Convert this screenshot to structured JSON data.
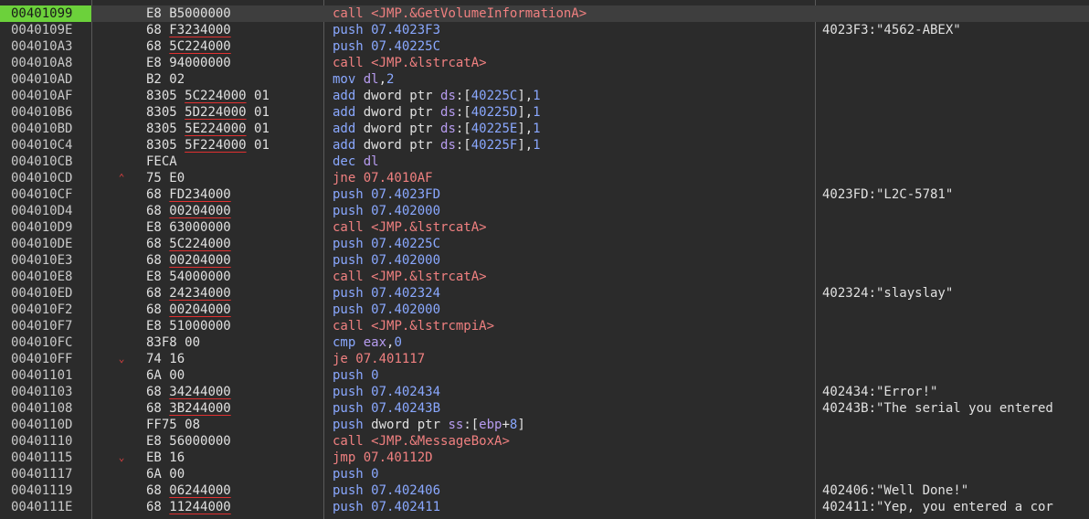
{
  "rows": [
    {
      "addr": "00401099",
      "bytes": "E8",
      "op": "B5000000",
      "ul": false,
      "arrow": "",
      "mn": "call",
      "args": [
        {
          "t": "<JMP.&GetVolumeInformationA>",
          "c": "tgt"
        }
      ],
      "cmt": "",
      "sel": true
    },
    {
      "addr": "0040109E",
      "bytes": "68",
      "op": "F3234000",
      "ul": true,
      "arrow": "",
      "mn": "push",
      "args": [
        {
          "t": "07.4023F3",
          "c": "num"
        }
      ],
      "cmt": "4023F3:\"4562-ABEX\""
    },
    {
      "addr": "004010A3",
      "bytes": "68",
      "op": "5C224000",
      "ul": true,
      "arrow": "",
      "mn": "push",
      "args": [
        {
          "t": "07.40225C",
          "c": "num"
        }
      ],
      "cmt": ""
    },
    {
      "addr": "004010A8",
      "bytes": "E8",
      "op": "94000000",
      "ul": false,
      "arrow": "",
      "mn": "call",
      "args": [
        {
          "t": "<JMP.&lstrcatA>",
          "c": "tgt"
        }
      ],
      "cmt": ""
    },
    {
      "addr": "004010AD",
      "bytes": "B2",
      "op": "02",
      "ul": false,
      "arrow": "",
      "mn": "mov",
      "args": [
        {
          "t": "dl",
          "c": "reg"
        },
        {
          "t": ",",
          "c": "txt"
        },
        {
          "t": "2",
          "c": "num"
        }
      ],
      "cmt": ""
    },
    {
      "addr": "004010AF",
      "bytes": "8305",
      "op": "5C224000",
      "tail": "01",
      "ul": true,
      "arrow": "",
      "mn": "add",
      "args": [
        {
          "t": "dword ptr ",
          "c": "txt"
        },
        {
          "t": "ds",
          "c": "reg"
        },
        {
          "t": ":[",
          "c": "txt"
        },
        {
          "t": "40225C",
          "c": "num"
        },
        {
          "t": "],",
          "c": "txt"
        },
        {
          "t": "1",
          "c": "num"
        }
      ],
      "cmt": ""
    },
    {
      "addr": "004010B6",
      "bytes": "8305",
      "op": "5D224000",
      "tail": "01",
      "ul": true,
      "arrow": "",
      "mn": "add",
      "args": [
        {
          "t": "dword ptr ",
          "c": "txt"
        },
        {
          "t": "ds",
          "c": "reg"
        },
        {
          "t": ":[",
          "c": "txt"
        },
        {
          "t": "40225D",
          "c": "num"
        },
        {
          "t": "],",
          "c": "txt"
        },
        {
          "t": "1",
          "c": "num"
        }
      ],
      "cmt": ""
    },
    {
      "addr": "004010BD",
      "bytes": "8305",
      "op": "5E224000",
      "tail": "01",
      "ul": true,
      "arrow": "",
      "mn": "add",
      "args": [
        {
          "t": "dword ptr ",
          "c": "txt"
        },
        {
          "t": "ds",
          "c": "reg"
        },
        {
          "t": ":[",
          "c": "txt"
        },
        {
          "t": "40225E",
          "c": "num"
        },
        {
          "t": "],",
          "c": "txt"
        },
        {
          "t": "1",
          "c": "num"
        }
      ],
      "cmt": ""
    },
    {
      "addr": "004010C4",
      "bytes": "8305",
      "op": "5F224000",
      "tail": "01",
      "ul": true,
      "arrow": "",
      "mn": "add",
      "args": [
        {
          "t": "dword ptr ",
          "c": "txt"
        },
        {
          "t": "ds",
          "c": "reg"
        },
        {
          "t": ":[",
          "c": "txt"
        },
        {
          "t": "40225F",
          "c": "num"
        },
        {
          "t": "],",
          "c": "txt"
        },
        {
          "t": "1",
          "c": "num"
        }
      ],
      "cmt": ""
    },
    {
      "addr": "004010CB",
      "bytes": "FECA",
      "op": "",
      "ul": false,
      "arrow": "",
      "mn": "dec",
      "args": [
        {
          "t": "dl",
          "c": "reg"
        }
      ],
      "cmt": ""
    },
    {
      "addr": "004010CD",
      "bytes": "75",
      "op": "E0",
      "ul": false,
      "arrow": "up",
      "mn": "jne",
      "args": [
        {
          "t": "07.4010AF",
          "c": "tgt"
        }
      ],
      "cmt": ""
    },
    {
      "addr": "004010CF",
      "bytes": "68",
      "op": "FD234000",
      "ul": true,
      "arrow": "",
      "mn": "push",
      "args": [
        {
          "t": "07.4023FD",
          "c": "num"
        }
      ],
      "cmt": "4023FD:\"L2C-5781\""
    },
    {
      "addr": "004010D4",
      "bytes": "68",
      "op": "00204000",
      "ul": true,
      "arrow": "",
      "mn": "push",
      "args": [
        {
          "t": "07.402000",
          "c": "num"
        }
      ],
      "cmt": ""
    },
    {
      "addr": "004010D9",
      "bytes": "E8",
      "op": "63000000",
      "ul": false,
      "arrow": "",
      "mn": "call",
      "args": [
        {
          "t": "<JMP.&lstrcatA>",
          "c": "tgt"
        }
      ],
      "cmt": ""
    },
    {
      "addr": "004010DE",
      "bytes": "68",
      "op": "5C224000",
      "ul": true,
      "arrow": "",
      "mn": "push",
      "args": [
        {
          "t": "07.40225C",
          "c": "num"
        }
      ],
      "cmt": ""
    },
    {
      "addr": "004010E3",
      "bytes": "68",
      "op": "00204000",
      "ul": true,
      "arrow": "",
      "mn": "push",
      "args": [
        {
          "t": "07.402000",
          "c": "num"
        }
      ],
      "cmt": ""
    },
    {
      "addr": "004010E8",
      "bytes": "E8",
      "op": "54000000",
      "ul": false,
      "arrow": "",
      "mn": "call",
      "args": [
        {
          "t": "<JMP.&lstrcatA>",
          "c": "tgt"
        }
      ],
      "cmt": ""
    },
    {
      "addr": "004010ED",
      "bytes": "68",
      "op": "24234000",
      "ul": true,
      "arrow": "",
      "mn": "push",
      "args": [
        {
          "t": "07.402324",
          "c": "num"
        }
      ],
      "cmt": "402324:\"slayslay\""
    },
    {
      "addr": "004010F2",
      "bytes": "68",
      "op": "00204000",
      "ul": true,
      "arrow": "",
      "mn": "push",
      "args": [
        {
          "t": "07.402000",
          "c": "num"
        }
      ],
      "cmt": ""
    },
    {
      "addr": "004010F7",
      "bytes": "E8",
      "op": "51000000",
      "ul": false,
      "arrow": "",
      "mn": "call",
      "args": [
        {
          "t": "<JMP.&lstrcmpiA>",
          "c": "tgt"
        }
      ],
      "cmt": ""
    },
    {
      "addr": "004010FC",
      "bytes": "83F8",
      "op": "00",
      "ul": false,
      "arrow": "",
      "mn": "cmp",
      "args": [
        {
          "t": "eax",
          "c": "reg"
        },
        {
          "t": ",",
          "c": "txt"
        },
        {
          "t": "0",
          "c": "num"
        }
      ],
      "cmt": ""
    },
    {
      "addr": "004010FF",
      "bytes": "74",
      "op": "16",
      "ul": false,
      "arrow": "down",
      "mn": "je",
      "args": [
        {
          "t": "07.401117",
          "c": "tgt"
        }
      ],
      "cmt": ""
    },
    {
      "addr": "00401101",
      "bytes": "6A",
      "op": "00",
      "ul": false,
      "arrow": "",
      "mn": "push",
      "args": [
        {
          "t": "0",
          "c": "num"
        }
      ],
      "cmt": ""
    },
    {
      "addr": "00401103",
      "bytes": "68",
      "op": "34244000",
      "ul": true,
      "arrow": "",
      "mn": "push",
      "args": [
        {
          "t": "07.402434",
          "c": "num"
        }
      ],
      "cmt": "402434:\"Error!\""
    },
    {
      "addr": "00401108",
      "bytes": "68",
      "op": "3B244000",
      "ul": true,
      "arrow": "",
      "mn": "push",
      "args": [
        {
          "t": "07.40243B",
          "c": "num"
        }
      ],
      "cmt": "40243B:\"The serial you entered"
    },
    {
      "addr": "0040110D",
      "bytes": "FF75",
      "op": "08",
      "ul": false,
      "arrow": "",
      "mn": "push",
      "args": [
        {
          "t": "dword ptr ",
          "c": "txt"
        },
        {
          "t": "ss",
          "c": "reg"
        },
        {
          "t": ":[",
          "c": "txt"
        },
        {
          "t": "ebp",
          "c": "reg"
        },
        {
          "t": "+",
          "c": "txt"
        },
        {
          "t": "8",
          "c": "num"
        },
        {
          "t": "]",
          "c": "txt"
        }
      ],
      "cmt": ""
    },
    {
      "addr": "00401110",
      "bytes": "E8",
      "op": "56000000",
      "ul": false,
      "arrow": "",
      "mn": "call",
      "args": [
        {
          "t": "<JMP.&MessageBoxA>",
          "c": "tgt"
        }
      ],
      "cmt": ""
    },
    {
      "addr": "00401115",
      "bytes": "EB",
      "op": "16",
      "ul": false,
      "arrow": "down",
      "mn": "jmp",
      "args": [
        {
          "t": "07.40112D",
          "c": "tgt"
        }
      ],
      "cmt": ""
    },
    {
      "addr": "00401117",
      "bytes": "6A",
      "op": "00",
      "ul": false,
      "arrow": "",
      "mn": "push",
      "args": [
        {
          "t": "0",
          "c": "num"
        }
      ],
      "cmt": ""
    },
    {
      "addr": "00401119",
      "bytes": "68",
      "op": "06244000",
      "ul": true,
      "arrow": "",
      "mn": "push",
      "args": [
        {
          "t": "07.402406",
          "c": "num"
        }
      ],
      "cmt": "402406:\"Well Done!\""
    },
    {
      "addr": "0040111E",
      "bytes": "68",
      "op": "11244000",
      "ul": true,
      "arrow": "",
      "mn": "push",
      "args": [
        {
          "t": "07.402411",
          "c": "num"
        }
      ],
      "cmt": "402411:\"Yep, you entered a cor"
    }
  ],
  "colors": {
    "background": "#2b2b2b",
    "selected_address": "#6cd13b",
    "call_mnemonic": "#f08080",
    "push_mnemonic": "#8aa8ff",
    "register": "#b79cf0",
    "operand_underline": "#e03030",
    "jump_arrow": "#e04040"
  },
  "icons": {
    "up": "jump-up-arrow-icon",
    "down": "jump-down-arrow-icon"
  }
}
